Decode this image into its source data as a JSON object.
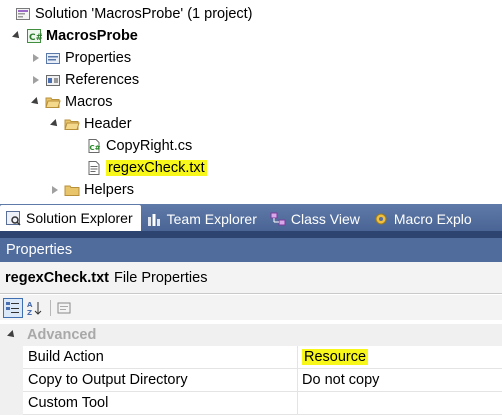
{
  "solution_explorer": {
    "solution_label": "Solution 'MacrosProbe' (1 project)",
    "project_label": "MacrosProbe",
    "items": {
      "properties": "Properties",
      "references": "References",
      "macros": "Macros",
      "header": "Header",
      "copyright": "CopyRight.cs",
      "regex": "regexCheck.txt",
      "helpers": "Helpers"
    }
  },
  "tabs": [
    {
      "label": "Solution Explorer",
      "icon": "solution-explorer-icon"
    },
    {
      "label": "Team Explorer",
      "icon": "team-explorer-icon"
    },
    {
      "label": "Class View",
      "icon": "class-view-icon"
    },
    {
      "label": "Macro Explo",
      "icon": "macro-explorer-icon"
    }
  ],
  "properties": {
    "title": "Properties",
    "object_name": "regexCheck.txt",
    "object_type": "File Properties",
    "category": "Advanced",
    "rows": [
      {
        "name": "Build Action",
        "value": "Resource"
      },
      {
        "name": "Copy to Output Directory",
        "value": "Do not copy"
      },
      {
        "name": "Custom Tool",
        "value": ""
      }
    ]
  },
  "colors": {
    "highlight": "#f7f71a",
    "tab_bar": "#4a6595",
    "panel_title": "#4f6c9c"
  }
}
